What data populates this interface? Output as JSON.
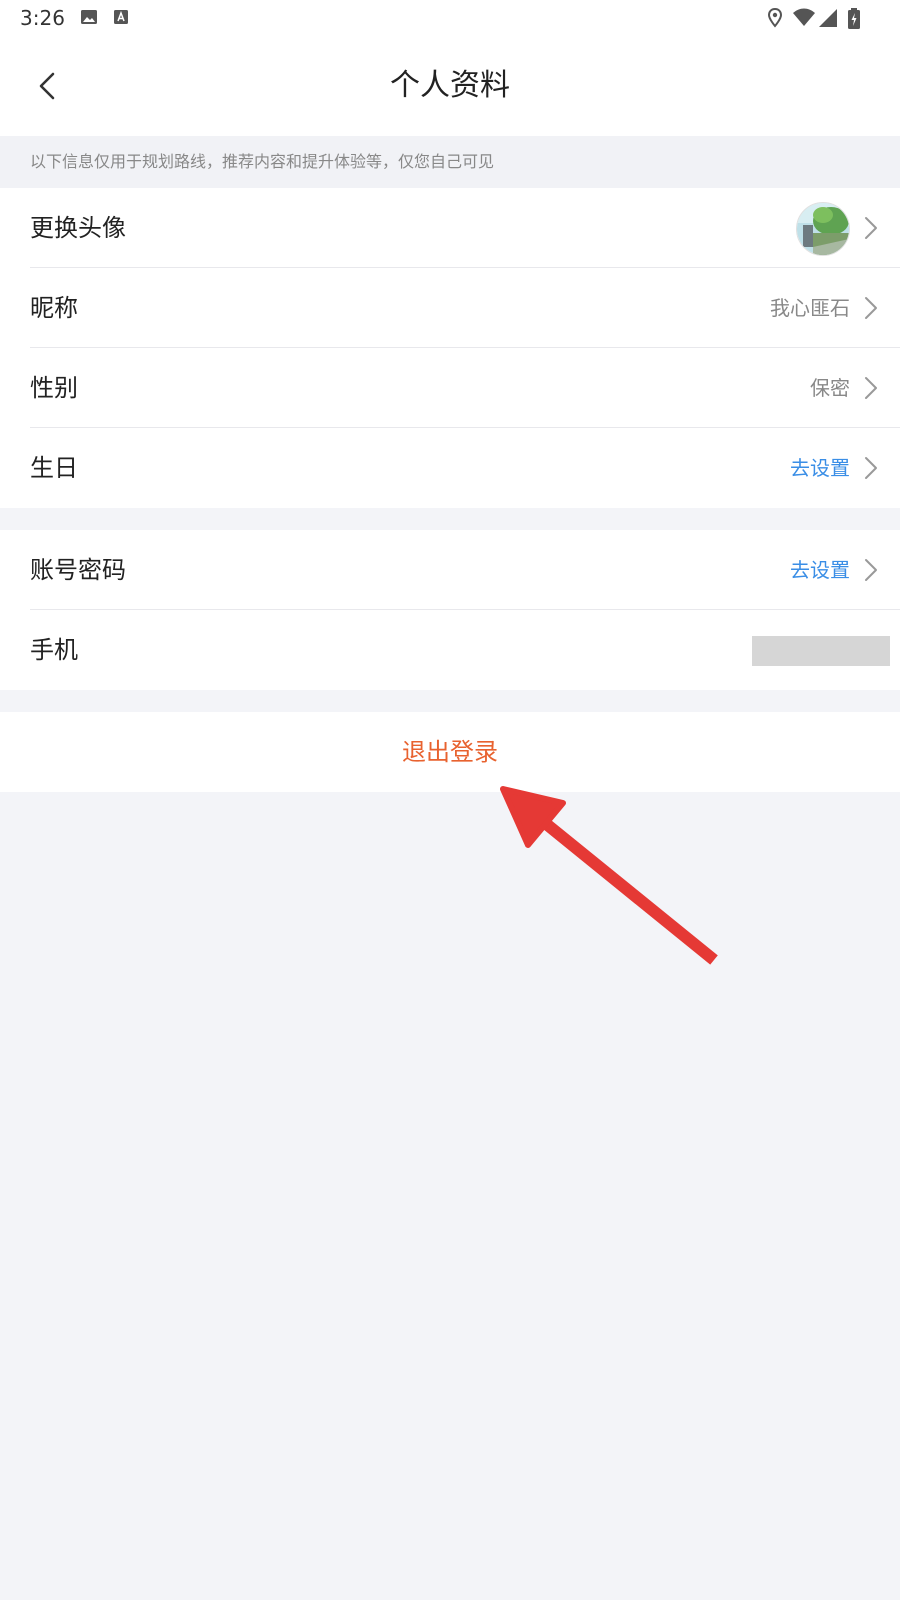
{
  "status_bar": {
    "time": "3:26"
  },
  "header": {
    "title": "个人资料"
  },
  "notice": {
    "text": "以下信息仅用于规划路线，推荐内容和提升体验等，仅您自己可见"
  },
  "profile_group": {
    "avatar_label": "更换头像",
    "nickname_label": "昵称",
    "nickname_value": "我心匪石",
    "gender_label": "性别",
    "gender_value": "保密",
    "birthday_label": "生日",
    "birthday_value": "去设置"
  },
  "account_group": {
    "password_label": "账号密码",
    "password_value": "去设置",
    "phone_label": "手机"
  },
  "logout": {
    "label": "退出登录"
  },
  "colors": {
    "link": "#3a8ee6",
    "logout": "#e8622f",
    "annotation_arrow": "#e53935",
    "background": "#f3f4f8"
  },
  "icons": [
    "image-icon",
    "text-a-icon",
    "location-icon",
    "wifi-icon",
    "signal-icon",
    "battery-icon",
    "back-arrow-icon",
    "chevron-right-icon"
  ]
}
